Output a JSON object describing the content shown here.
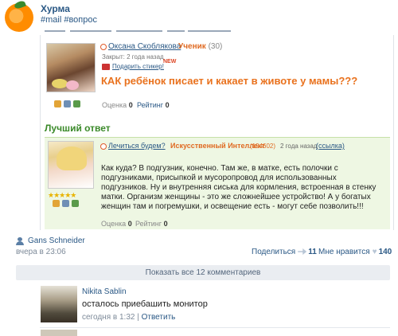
{
  "post": {
    "title": "Хурма",
    "tags": "#mail #вопрос"
  },
  "question": {
    "user_name": "Оксана Скоблякова",
    "user_rank": "Ученик",
    "user_points": "(30)",
    "closed_info": "Закрыт: 2 года назад",
    "gift_link": "Подарить стикер!",
    "new_badge": "NEW",
    "text": "КАК ребёнок писает и какает в животе у мамы???",
    "rating_label": "Оценка",
    "rating_value": "0",
    "score_label": "Рейтинг",
    "score_value": "0"
  },
  "best_answer": {
    "heading": "Лучший ответ",
    "user_name": "Лечиться будем?",
    "user_rank": "Искусственный Интеллект",
    "user_points": "(194602)",
    "time": "2 года назад",
    "link": "(ссылка)",
    "text": "Как куда? В подгузник, конечно. Там же, в матке, есть полочки с подгузниками, присыпкой и мусоропровод для использованных подгузников. Ну и внутренняя сиська для кормления, встроенная в стенку матки. Организм женщины - это же сложнейшее устройство! А у богатых женщин там и погремушки, и освещение есть - могут себе позволить!!!",
    "stars": "★★★★★",
    "rating_label": "Оценка",
    "rating_value": "0",
    "score_label": "Рейтинг",
    "score_value": "0"
  },
  "footer": {
    "author": "Gans Schneider",
    "time": "вчера в 23:06",
    "share_label": "Поделиться",
    "share_count": "11",
    "like_label": "Мне нравится",
    "like_count": "140",
    "show_all": "Показать все 12 комментариев"
  },
  "comment": {
    "author": "Nikita Sablin",
    "text": "осталось приебашить монитор",
    "time": "сегодня в 1:32",
    "separator": "|",
    "reply": "Ответить"
  },
  "icons": {
    "share": "share-icon",
    "like": "heart-icon",
    "author": "user-icon"
  },
  "colors": {
    "link": "#2a5885",
    "accent_orange": "#e9721e",
    "best_answer_green": "#3b8a2a",
    "answer_bg": "#eef7e3"
  }
}
